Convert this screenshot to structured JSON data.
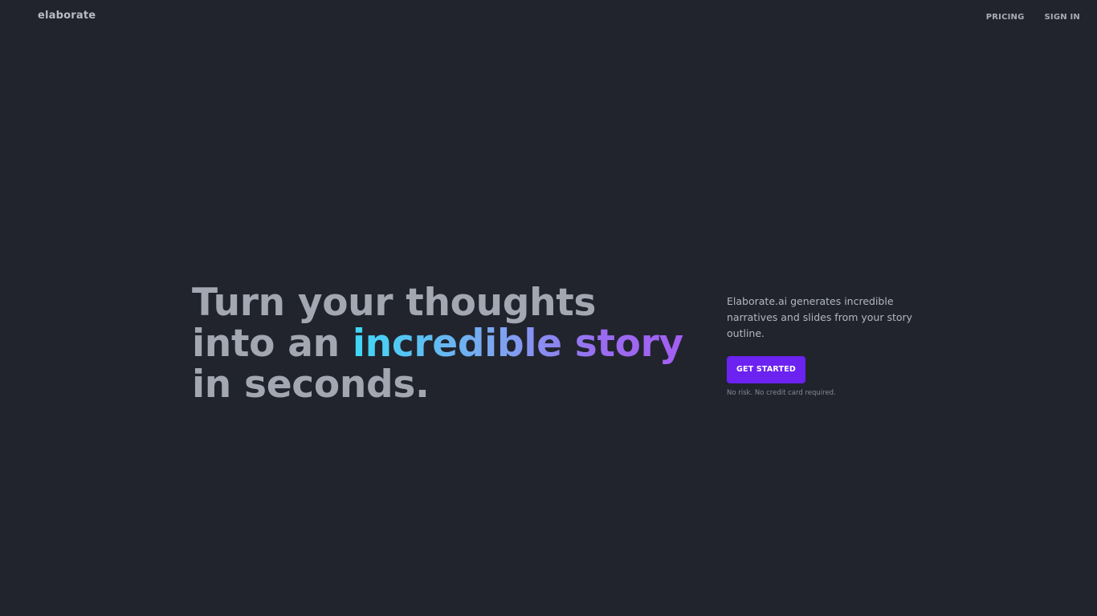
{
  "header": {
    "logo": "elaborate",
    "nav": [
      {
        "label": "PRICING"
      },
      {
        "label": "SIGN IN"
      }
    ]
  },
  "hero": {
    "line1": "Turn your thoughts",
    "line2_prefix": "into an ",
    "line2_highlight": "incredible story",
    "line3": "in seconds."
  },
  "cta_panel": {
    "description": "Elaborate.ai generates incredible narratives and slides from your story outline.",
    "button_label": "GET STARTED",
    "note": "No risk. No credit card required."
  },
  "colors": {
    "background": "#21242d",
    "accent": "#6c22f1",
    "gradient_start": "#3fd8f6",
    "gradient_end": "#a35ef2"
  }
}
